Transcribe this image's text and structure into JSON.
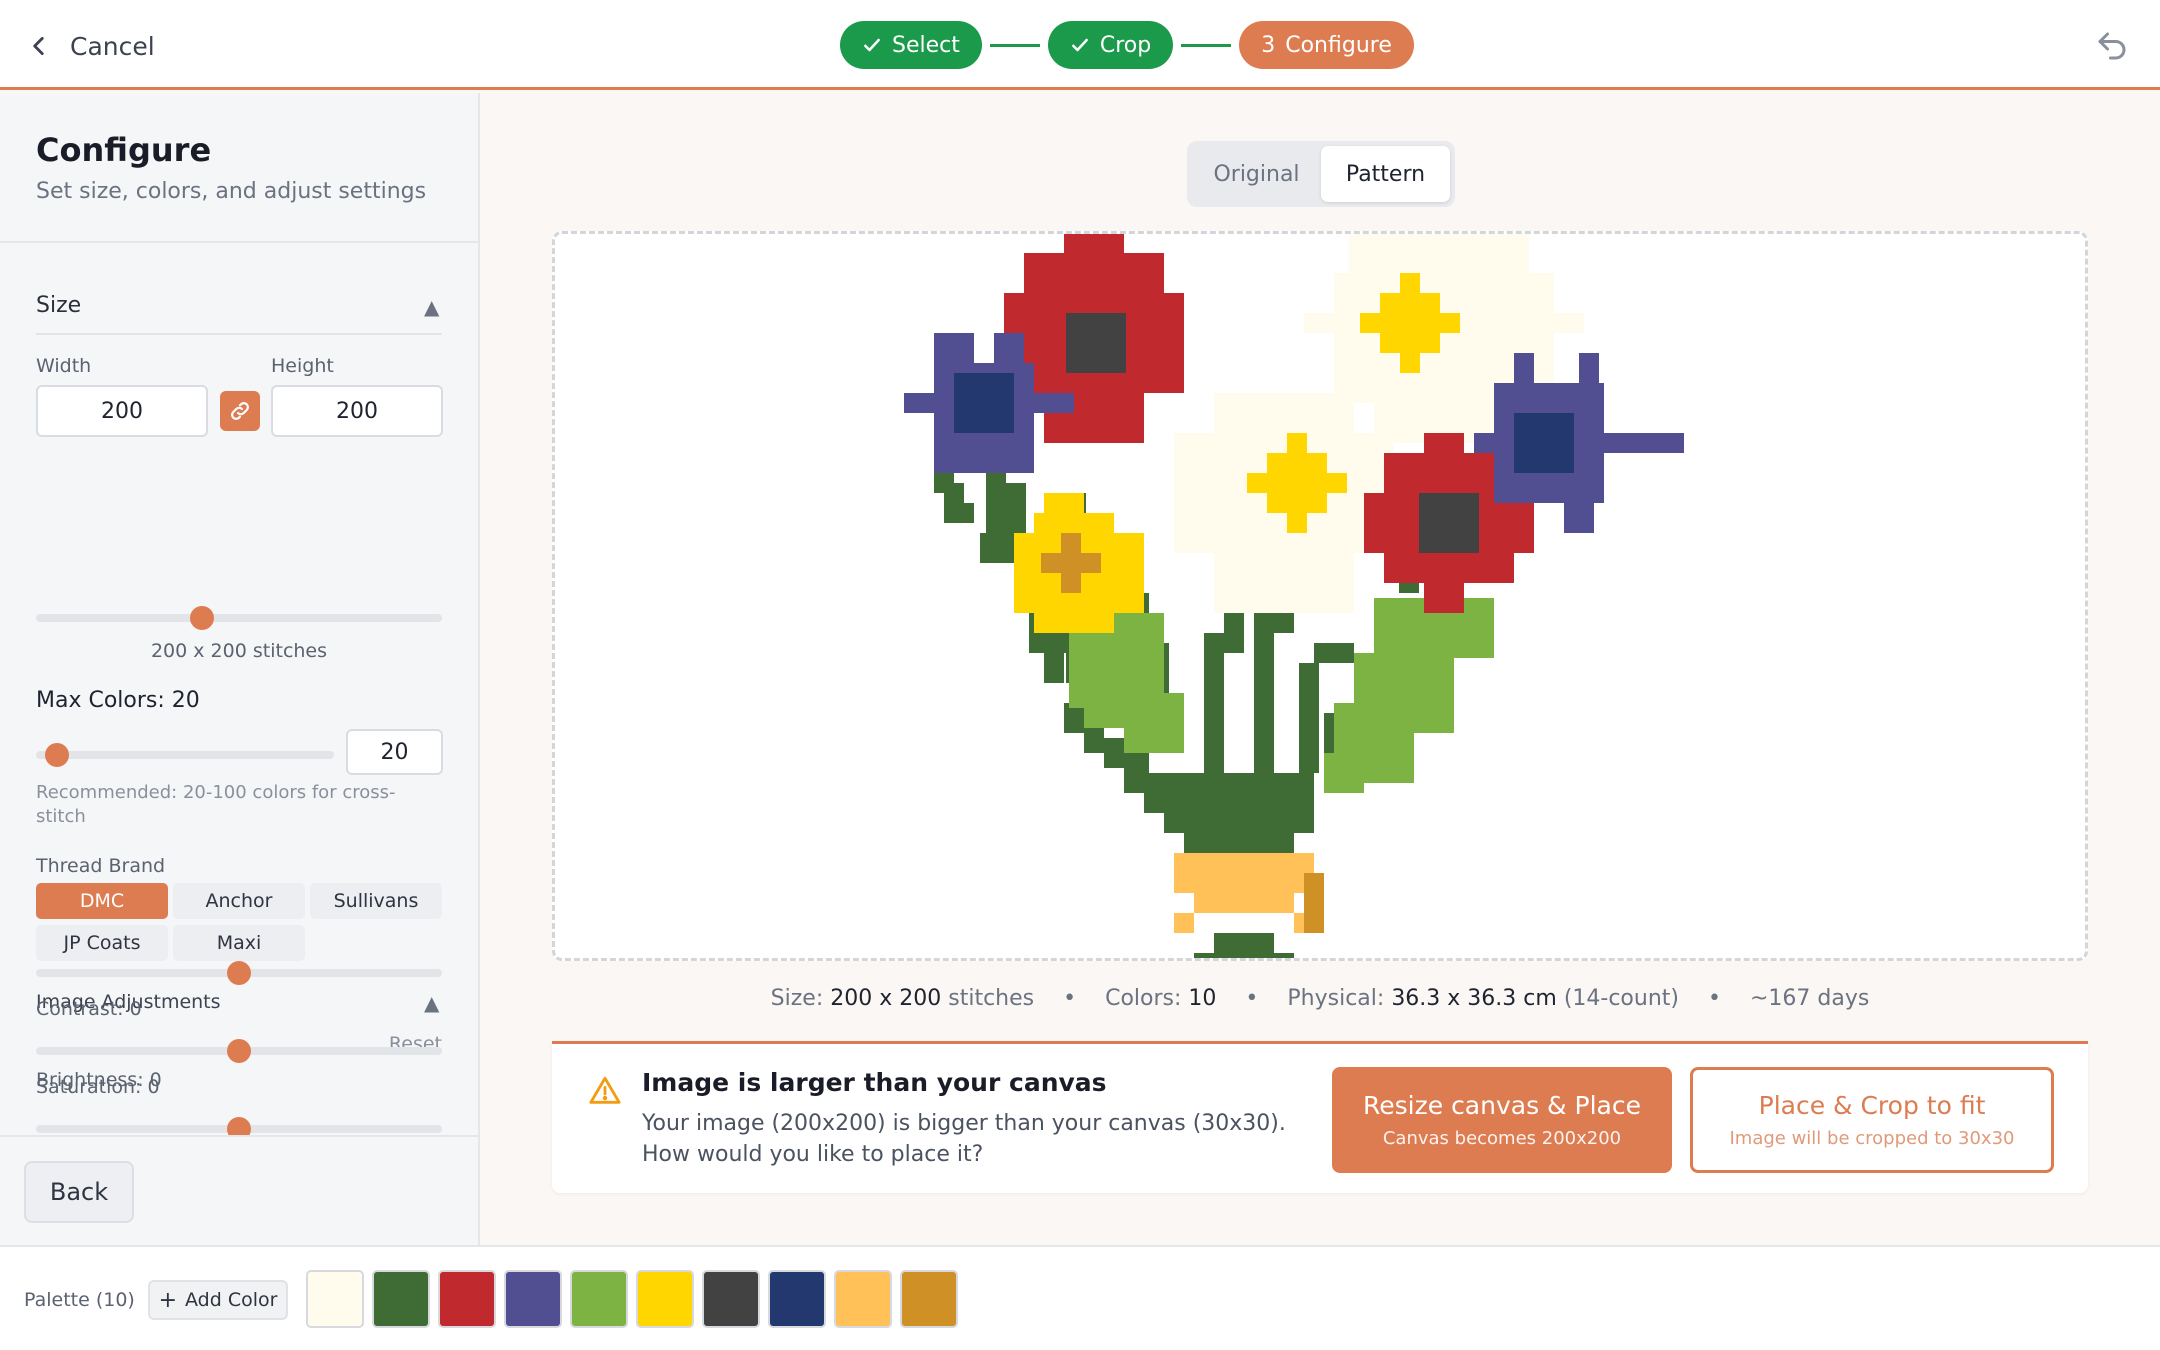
{
  "topbar": {
    "cancel_label": "Cancel",
    "steps": [
      {
        "label": "Select",
        "state": "done"
      },
      {
        "label": "Crop",
        "state": "done"
      },
      {
        "number": "3",
        "label": "Configure",
        "state": "active"
      }
    ]
  },
  "sidebar": {
    "title": "Configure",
    "subtitle": "Set size, colors, and adjust settings",
    "size": {
      "section_title": "Size",
      "caret": "▲",
      "width_label": "Width",
      "height_label": "Height",
      "width_value": "200",
      "height_value": "200",
      "slider_fraction": 0.41,
      "summary": "200 x 200 stitches"
    },
    "max_colors": {
      "label": "Max Colors: 20",
      "value": "20",
      "slider_fraction": 0.07,
      "hint": "Recommended: 20-100 colors for cross-stitch"
    },
    "thread_brand": {
      "label": "Thread Brand",
      "options": [
        "DMC",
        "Anchor",
        "Sullivans",
        "JP Coats",
        "Maxi"
      ],
      "selected": "DMC"
    },
    "adjustments": {
      "section_title": "Image Adjustments",
      "caret": "▲",
      "reset_label": "Reset",
      "brightness_label": "Brightness: 0",
      "contrast_label": "Contrast: 0",
      "saturation_label": "Saturation: 0",
      "brightness_fraction": 0.5,
      "contrast_fraction": 0.5,
      "saturation_fraction": 0.5
    },
    "back_label": "Back"
  },
  "main": {
    "view_toggle": {
      "options": [
        "Original",
        "Pattern"
      ],
      "selected": "Pattern"
    },
    "stats": {
      "size_label": "Size:",
      "size_value": "200 x 200",
      "size_unit": "stitches",
      "colors_label": "Colors:",
      "colors_value": "10",
      "physical_label": "Physical:",
      "physical_value": "36.3 x 36.3 cm",
      "physical_count": "(14-count)",
      "duration": "~167 days",
      "separator": "•"
    },
    "warning": {
      "title": "Image is larger than your canvas",
      "text": "Your image (200x200) is bigger than your canvas (30x30). How would you like to place it?",
      "resize_label": "Resize canvas & Place",
      "resize_sub": "Canvas becomes 200x200",
      "crop_label": "Place & Crop to fit",
      "crop_sub": "Image will be cropped to 30x30"
    }
  },
  "palette": {
    "label": "Palette (10)",
    "add_label": "Add Color",
    "colors": [
      "#fffcee",
      "#3f6b35",
      "#c0292e",
      "#514f91",
      "#7db342",
      "#ffd600",
      "#424242",
      "#23386f",
      "#ffc158",
      "#cf9026"
    ]
  },
  "colors": {
    "accent": "#dd7c51",
    "success": "#1b9a4b"
  }
}
